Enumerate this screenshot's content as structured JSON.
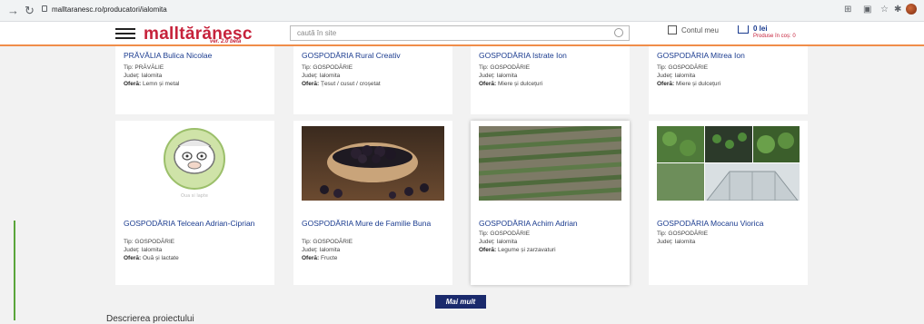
{
  "browser": {
    "url": "malltaranesc.ro/producatori/ialomita"
  },
  "header": {
    "logo": "malltărănesc",
    "logo_sub": "ver. 2.0 beta",
    "search_placeholder": "caută în site",
    "account_label": "Contul meu",
    "cart_price": "0 lei",
    "cart_count": "Produse în coș: 0"
  },
  "row1": [
    {
      "title": "PRĂVĂLIA Bulica Nicolae",
      "tip": "Tip: PRĂVĂLIE",
      "judet": "Județ: Ialomita",
      "ofera_label": "Oferă:",
      "ofera": "Lemn și metal"
    },
    {
      "title": "GOSPODĂRIA Rural Creativ",
      "tip": "Tip: GOSPODĂRIE",
      "judet": "Județ: Ialomita",
      "ofera_label": "Oferă:",
      "ofera": "Țesut / cusut / croșetat"
    },
    {
      "title": "GOSPODĂRIA Istrate Ion",
      "tip": "Tip: GOSPODĂRIE",
      "judet": "Județ: Ialomita",
      "ofera_label": "Oferă:",
      "ofera": "Miere și dulcețuri"
    },
    {
      "title": "GOSPODĂRIA Mitrea Ion",
      "tip": "Tip: GOSPODĂRIE",
      "judet": "Județ: Ialomita",
      "ofera_label": "Oferă:",
      "ofera": "Miere și dulcețuri"
    }
  ],
  "row2": [
    {
      "title": "GOSPODĂRIA Telcean Adrian-Ciprian",
      "tip": "Tip: GOSPODĂRIE",
      "judet": "Județ: Ialomita",
      "ofera_label": "Oferă:",
      "ofera": "Ouă și lactate",
      "image": "sheep-logo"
    },
    {
      "title": "GOSPODĂRIA Mure de Familie Buna",
      "tip": "Tip: GOSPODĂRIE",
      "judet": "Județ: Ialomita",
      "ofera_label": "Oferă:",
      "ofera": "Fructe",
      "image": "blackberries-bowl"
    },
    {
      "title": "GOSPODĂRIA Achim Adrian",
      "tip": "Tip: GOSPODĂRIE",
      "judet": "Județ: Ialomita",
      "ofera_label": "Oferă:",
      "ofera": "Legume și zarzavaturi",
      "image": "vegetable-field"
    },
    {
      "title": "GOSPODĂRIA Mocanu Viorica",
      "tip": "Tip: GOSPODĂRIE",
      "judet": "Județ: Ialomita",
      "image": "greenhouse-collage"
    }
  ],
  "more_button": "Mai mult",
  "section_title": "Descrierea proiectului"
}
